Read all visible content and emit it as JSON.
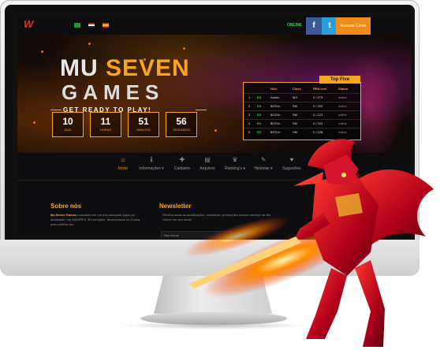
{
  "topbar": {
    "online_label": "ONLINE",
    "create_account_label": "Acessar Conta",
    "facebook_glyph": "f",
    "twitter_glyph": "t",
    "logo_glyph": "W"
  },
  "hero": {
    "title_part1": "MU",
    "title_part2": "SEVEN",
    "title_line2": "GAMES",
    "tagline": "GET READY TO PLAY!",
    "countdown": [
      {
        "value": "10",
        "label": "DIAS"
      },
      {
        "value": "11",
        "label": "HORAS"
      },
      {
        "value": "51",
        "label": "MINUTOS"
      },
      {
        "value": "56",
        "label": "SEGUNDOS"
      }
    ]
  },
  "top_five": {
    "title": "Top Five",
    "columns": [
      "Nick",
      "Class",
      "RR/Level",
      "Status"
    ],
    "rows": [
      {
        "rank": "1",
        "tag": "EX",
        "nick": "Admin",
        "class": "MG",
        "level": "0 / 273",
        "status": "online"
      },
      {
        "rank": "2",
        "tag": "EX",
        "nick": "$GS1n",
        "class": "SM",
        "level": "0 / 220",
        "status": "online"
      },
      {
        "rank": "3",
        "tag": "EX",
        "nick": "$GS1n",
        "class": "SM",
        "level": "0 / 123",
        "status": "online"
      },
      {
        "rank": "4",
        "tag": "EX",
        "nick": "$GS1n",
        "class": "SM",
        "level": "0 / 243",
        "status": "online"
      },
      {
        "rank": "5",
        "tag": "EX",
        "nick": "$GS1n",
        "class": "SM",
        "level": "0 / 128",
        "status": "online"
      }
    ]
  },
  "nav": {
    "items": [
      {
        "label": "Início",
        "icon": "home-icon",
        "glyph": "⌂"
      },
      {
        "label": "Informações ▾",
        "icon": "info-icon",
        "glyph": "ℹ"
      },
      {
        "label": "Cadastro",
        "icon": "user-plus-icon",
        "glyph": "✚"
      },
      {
        "label": "Arquivos",
        "icon": "folder-icon",
        "glyph": "▤"
      },
      {
        "label": "Ranking's ▾",
        "icon": "trophy-icon",
        "glyph": "♛"
      },
      {
        "label": "Histórias ▾",
        "icon": "book-icon",
        "glyph": "✎"
      },
      {
        "label": "Sugestões",
        "icon": "heart-icon",
        "glyph": "♥"
      }
    ]
  },
  "about": {
    "title": "Sobre nós",
    "text_strong": "Mu Seven Games",
    "text": " buscando ser um dos principais jogos da atualidade, um MMORPG 3D completo, desenvolvido na Coreia pela webZen Inc."
  },
  "newsletter": {
    "title": "Newsletter",
    "text": "Receba todas as atualizações, novidades, promoções nossos servidor de Mu Online em seu email.",
    "input_placeholder": "Seu Nome"
  },
  "colors": {
    "accent": "#f7a51c",
    "online": "#3fd04f",
    "facebook": "#3b5998",
    "twitter": "#2a9fd6"
  }
}
